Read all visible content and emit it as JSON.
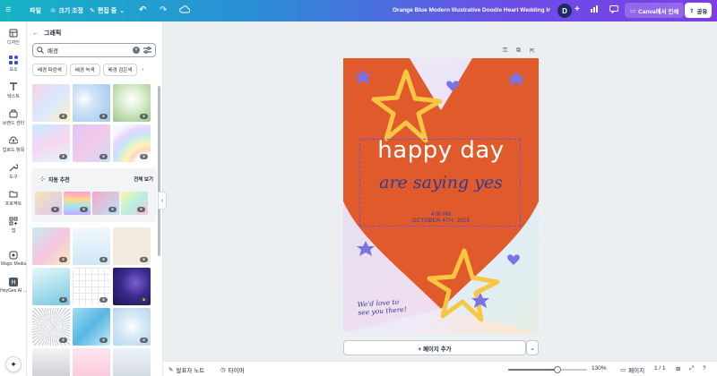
{
  "topbar": {
    "file_label": "파일",
    "resize_label": "크기 조정",
    "edit_label": "편집 중",
    "doc_title": "Orange Blue Modern Illustrative Doodle Heart Wedding Invi...",
    "avatar_letter": "D",
    "print_label": "Canva에서 인쇄",
    "share_label": "공유"
  },
  "rail": {
    "items": [
      {
        "label": "디자인",
        "icon": "design-icon"
      },
      {
        "label": "요소",
        "icon": "elements-icon"
      },
      {
        "label": "텍스트",
        "icon": "text-icon"
      },
      {
        "label": "브랜드 센터",
        "icon": "brand-icon"
      },
      {
        "label": "업로드 항목",
        "icon": "upload-icon"
      },
      {
        "label": "도구",
        "icon": "tools-icon"
      },
      {
        "label": "프로젝트",
        "icon": "folder-icon"
      },
      {
        "label": "앱",
        "icon": "apps-icon"
      },
      {
        "label": "Magic Media",
        "icon": "magic-media-icon"
      },
      {
        "label": "HeyGen AI ...",
        "icon": "heygen-icon"
      }
    ]
  },
  "panel": {
    "back_title": "그래픽",
    "search_value": "배경",
    "chips": [
      "배경 파란색",
      "배경 녹색",
      "배경 검은색"
    ],
    "auto_title": "자동 추천",
    "auto_all": "전체 보기"
  },
  "canvas": {
    "happy": "happy day",
    "script": "are saying yes",
    "time": "4:00 PM",
    "date": "OCTOBER 4TH, 2025",
    "bottom_line1": "We'd love to",
    "bottom_line2": "see you there!",
    "add_page": "+ 페이지 추가"
  },
  "bottombar": {
    "notes": "발표자 노트",
    "timer": "타이머",
    "zoom": "130%",
    "zoom_fraction": 0.62,
    "pages_label": "페이지",
    "page_count": "1 / 1"
  },
  "colors": {
    "heart": "#e05a2b",
    "star": "#f7c744",
    "script": "#2c3e8e",
    "accent": "#7b3fe4"
  }
}
